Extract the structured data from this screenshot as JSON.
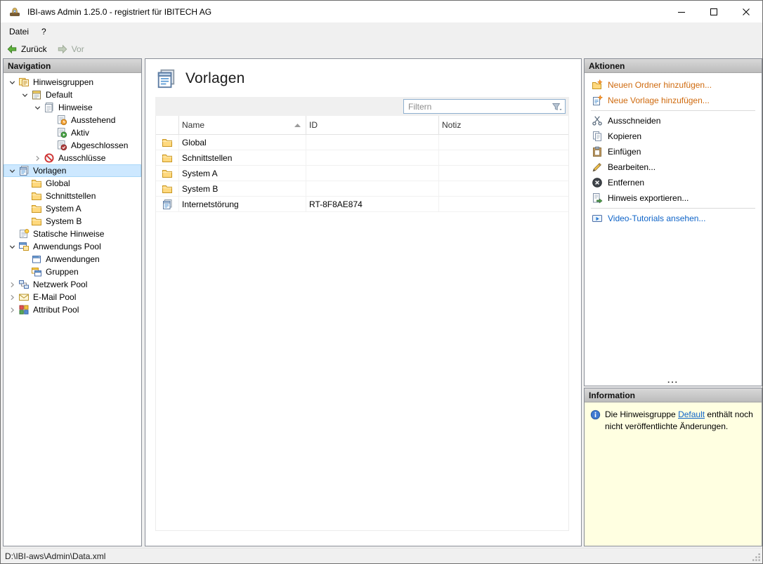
{
  "window": {
    "title": "IBI-aws Admin 1.25.0 - registriert für IBITECH AG",
    "icon": "app-icon"
  },
  "menubar": {
    "items": [
      "Datei",
      "?"
    ]
  },
  "toolbar": {
    "back": {
      "label": "Zurück",
      "icon": "back-arrow-icon",
      "enabled": true
    },
    "forward": {
      "label": "Vor",
      "icon": "forward-arrow-icon",
      "enabled": false
    }
  },
  "navigation": {
    "header": "Navigation",
    "tree": [
      {
        "label": "Hinweisgruppen",
        "level": 0,
        "state": "expanded",
        "icon": "hinweisgruppen-icon",
        "selected": false
      },
      {
        "label": "Default",
        "level": 1,
        "state": "expanded",
        "icon": "hinweisgruppe-default-icon",
        "selected": false
      },
      {
        "label": "Hinweise",
        "level": 2,
        "state": "expanded",
        "icon": "hinweise-icon",
        "selected": false
      },
      {
        "label": "Ausstehend",
        "level": 3,
        "state": "leaf",
        "icon": "hinweis-ausstehend-icon",
        "selected": false
      },
      {
        "label": "Aktiv",
        "level": 3,
        "state": "leaf",
        "icon": "hinweis-aktiv-icon",
        "selected": false
      },
      {
        "label": "Abgeschlossen",
        "level": 3,
        "state": "leaf",
        "icon": "hinweis-abgeschlossen-icon",
        "selected": false
      },
      {
        "label": "Ausschlüsse",
        "level": 2,
        "state": "collapsed",
        "icon": "ausschluesse-icon",
        "selected": false
      },
      {
        "label": "Vorlagen",
        "level": 0,
        "state": "expanded",
        "icon": "vorlagen-icon",
        "selected": true
      },
      {
        "label": "Global",
        "level": 1,
        "state": "leaf",
        "icon": "folder-icon",
        "selected": false
      },
      {
        "label": "Schnittstellen",
        "level": 1,
        "state": "leaf",
        "icon": "folder-icon",
        "selected": false
      },
      {
        "label": "System A",
        "level": 1,
        "state": "leaf",
        "icon": "folder-icon",
        "selected": false
      },
      {
        "label": "System B",
        "level": 1,
        "state": "leaf",
        "icon": "folder-icon",
        "selected": false
      },
      {
        "label": "Statische Hinweise",
        "level": 0,
        "state": "leaf",
        "icon": "statische-hinweise-icon",
        "selected": false
      },
      {
        "label": "Anwendungs Pool",
        "level": 0,
        "state": "expanded",
        "icon": "anwendungs-pool-icon",
        "selected": false
      },
      {
        "label": "Anwendungen",
        "level": 1,
        "state": "leaf",
        "icon": "anwendungen-icon",
        "selected": false
      },
      {
        "label": "Gruppen",
        "level": 1,
        "state": "leaf",
        "icon": "gruppen-icon",
        "selected": false
      },
      {
        "label": "Netzwerk Pool",
        "level": 0,
        "state": "collapsed",
        "icon": "netzwerk-pool-icon",
        "selected": false
      },
      {
        "label": "E-Mail Pool",
        "level": 0,
        "state": "collapsed",
        "icon": "email-pool-icon",
        "selected": false
      },
      {
        "label": "Attribut Pool",
        "level": 0,
        "state": "collapsed",
        "icon": "attribut-pool-icon",
        "selected": false
      }
    ]
  },
  "content": {
    "title": "Vorlagen",
    "title_icon": "vorlagen-icon",
    "filter": {
      "placeholder": "Filtern",
      "icon": "filter-icon"
    },
    "table": {
      "columns": [
        {
          "label": "Name",
          "sorted": "asc"
        },
        {
          "label": "ID"
        },
        {
          "label": "Notiz"
        }
      ],
      "rows": [
        {
          "icon": "folder-icon",
          "name": "Global",
          "id": "",
          "notiz": ""
        },
        {
          "icon": "folder-icon",
          "name": "Schnittstellen",
          "id": "",
          "notiz": ""
        },
        {
          "icon": "folder-icon",
          "name": "System A",
          "id": "",
          "notiz": ""
        },
        {
          "icon": "folder-icon",
          "name": "System B",
          "id": "",
          "notiz": ""
        },
        {
          "icon": "vorlage-icon",
          "name": "Internetstörung",
          "id": "RT-8F8AE874",
          "notiz": ""
        }
      ]
    }
  },
  "actions": {
    "header": "Aktionen",
    "groups": [
      {
        "items": [
          {
            "label": "Neuen Ordner hinzufügen...",
            "icon": "new-folder-icon",
            "style": "link-orange"
          },
          {
            "label": "Neue Vorlage hinzufügen...",
            "icon": "new-template-icon",
            "style": "link-orange"
          }
        ]
      },
      {
        "items": [
          {
            "label": "Ausschneiden",
            "icon": "cut-icon",
            "style": "normal"
          },
          {
            "label": "Kopieren",
            "icon": "copy-icon",
            "style": "normal"
          },
          {
            "label": "Einfügen",
            "icon": "paste-icon",
            "style": "normal"
          },
          {
            "label": "Bearbeiten...",
            "icon": "edit-icon",
            "style": "normal"
          },
          {
            "label": "Entfernen",
            "icon": "remove-icon",
            "style": "normal"
          },
          {
            "label": "Hinweis exportieren...",
            "icon": "export-icon",
            "style": "normal"
          }
        ]
      },
      {
        "items": [
          {
            "label": "Video-Tutorials ansehen...",
            "icon": "video-icon",
            "style": "link-blue"
          }
        ]
      }
    ],
    "splitter_dots": "..."
  },
  "information": {
    "header": "Information",
    "icon": "info-icon",
    "message": {
      "before": "Die Hinweisgruppe ",
      "link": "Default",
      "after": " enthält noch nicht veröffentlichte Änderungen."
    }
  },
  "statusbar": {
    "path": "D:\\IBI-aws\\Admin\\Data.xml"
  }
}
